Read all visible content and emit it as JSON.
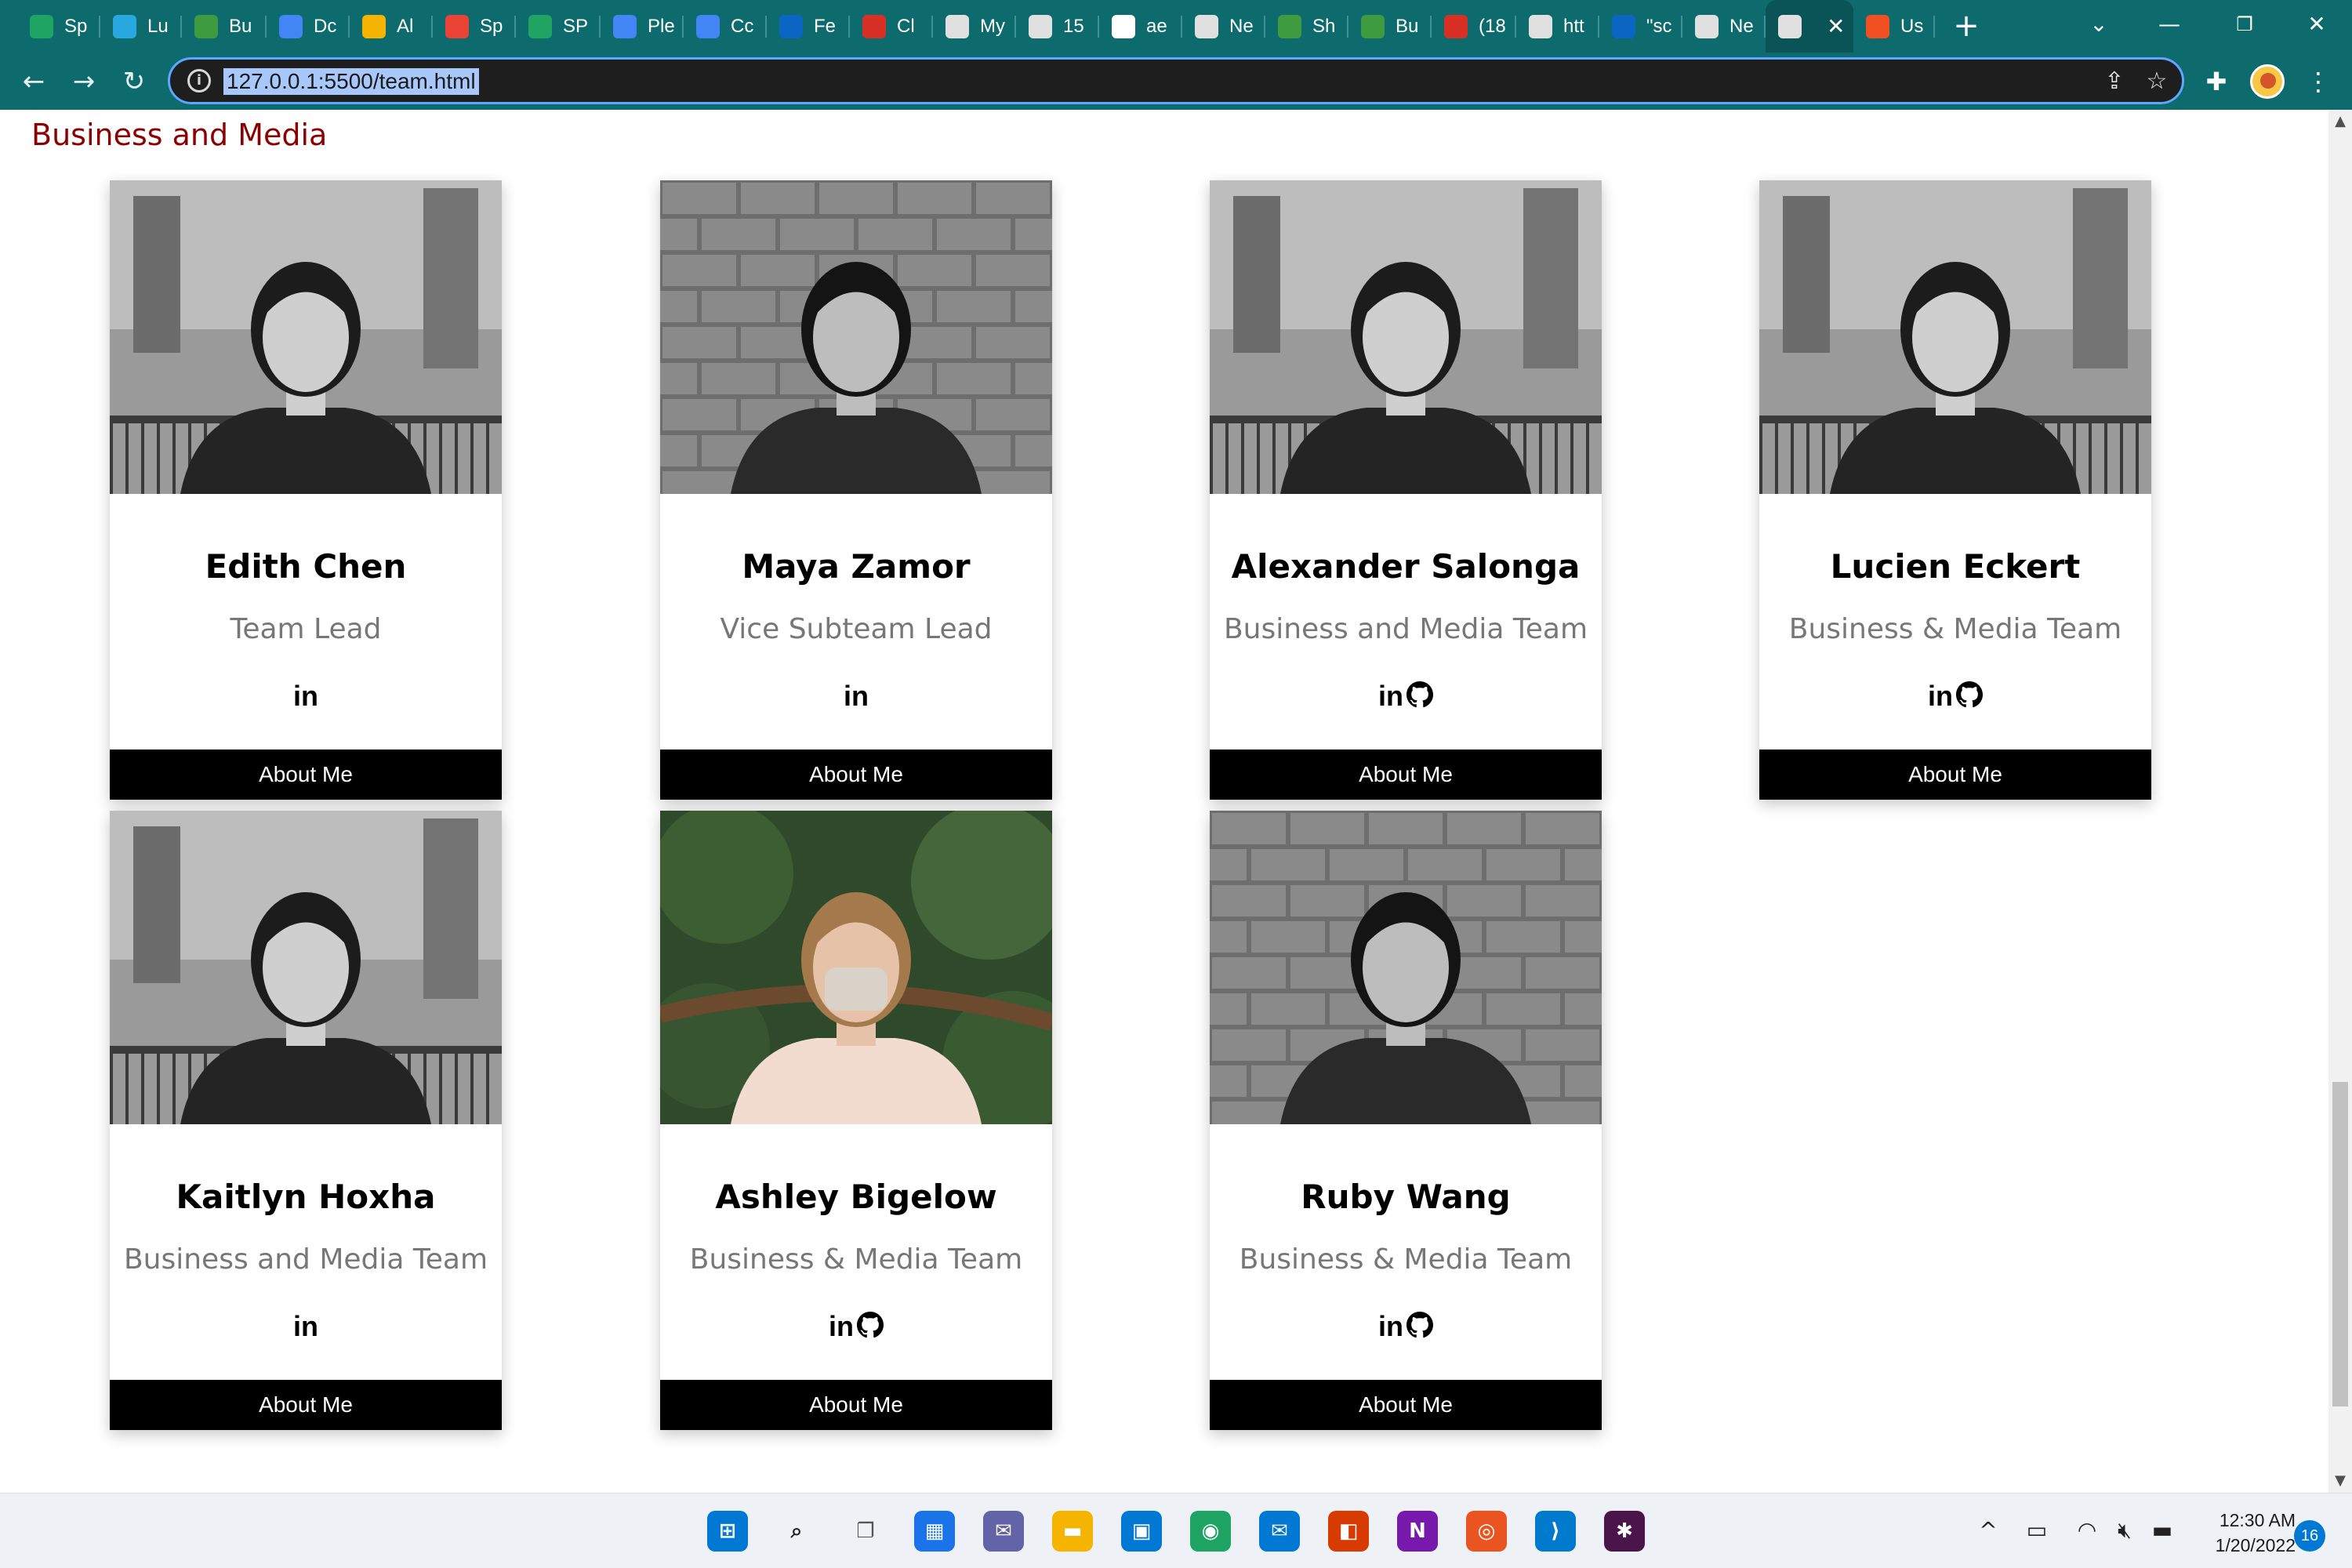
{
  "browser": {
    "tabs": [
      {
        "label": "Sp",
        "icon": "google-drive-icon",
        "color": "#1fa463"
      },
      {
        "label": "Lu",
        "icon": "lucid-icon",
        "color": "#29a8e0"
      },
      {
        "label": "Bu",
        "icon": "leaf-icon",
        "color": "#3f9b40"
      },
      {
        "label": "Dc",
        "icon": "google-docs-icon",
        "color": "#4285f4"
      },
      {
        "label": "Al",
        "icon": "google-slides-icon",
        "color": "#f4b400"
      },
      {
        "label": "Sp",
        "icon": "gmail-icon",
        "color": "#ea4335"
      },
      {
        "label": "SP",
        "icon": "google-drive-icon",
        "color": "#1fa463"
      },
      {
        "label": "Ple",
        "icon": "google-docs-icon",
        "color": "#4285f4"
      },
      {
        "label": "Cc",
        "icon": "google-calendar-icon",
        "color": "#4285f4"
      },
      {
        "label": "Fe",
        "icon": "linkedin-icon",
        "color": "#0a66c2"
      },
      {
        "label": "Cl",
        "icon": "shield-icon",
        "color": "#d93025"
      },
      {
        "label": "My",
        "icon": "globe-icon",
        "color": "#e0e0e0"
      },
      {
        "label": "15",
        "icon": "globe-icon",
        "color": "#e0e0e0"
      },
      {
        "label": "ae",
        "icon": "google-icon",
        "color": "#ffffff"
      },
      {
        "label": "Ne",
        "icon": "chrome-icon",
        "color": "#e0e0e0"
      },
      {
        "label": "Sh",
        "icon": "leaf-icon",
        "color": "#3f9b40"
      },
      {
        "label": "Bu",
        "icon": "leaf-icon",
        "color": "#3f9b40"
      },
      {
        "label": "(18",
        "icon": "handshake-icon",
        "color": "#d93025"
      },
      {
        "label": "htt",
        "icon": "globe-icon",
        "color": "#e0e0e0"
      },
      {
        "label": "\"sc",
        "icon": "linkedin-icon",
        "color": "#0a66c2"
      },
      {
        "label": "Ne",
        "icon": "chrome-icon",
        "color": "#e0e0e0"
      },
      {
        "label": "",
        "icon": "globe-icon",
        "color": "#e0e0e0",
        "active": true
      },
      {
        "label": "Us",
        "icon": "microsoft-icon",
        "color": "#f25022"
      }
    ],
    "url": "127.0.0.1:5500/team.html"
  },
  "page": {
    "section_title": "Business and Media",
    "button_label": "About Me",
    "members": [
      {
        "name": "Edith Chen",
        "role": "Team Lead",
        "github": false,
        "photo": "bw-outdoor"
      },
      {
        "name": "Maya Zamor",
        "role": "Vice Subteam Lead",
        "github": false,
        "photo": "bw-brick"
      },
      {
        "name": "Alexander Salonga",
        "role": "Business and Media Team",
        "github": true,
        "photo": "bw-outdoor"
      },
      {
        "name": "Lucien Eckert",
        "role": "Business & Media Team",
        "github": true,
        "photo": "bw-outdoor"
      },
      {
        "name": "Kaitlyn Hoxha",
        "role": "Business and Media Team",
        "github": false,
        "photo": "bw-outdoor"
      },
      {
        "name": "Ashley Bigelow",
        "role": "Business & Media Team",
        "github": true,
        "photo": "color-foliage"
      },
      {
        "name": "Ruby Wang",
        "role": "Business & Media Team",
        "github": true,
        "photo": "bw-brick"
      }
    ]
  },
  "taskbar": {
    "apps": [
      {
        "icon": "windows-start-icon",
        "color": "#0078d4"
      },
      {
        "icon": "search-icon",
        "color": "#222222"
      },
      {
        "icon": "task-view-icon",
        "color": "#555555"
      },
      {
        "icon": "widgets-icon",
        "color": "#1a73e8"
      },
      {
        "icon": "teams-chat-icon",
        "color": "#6264a7"
      },
      {
        "icon": "file-explorer-icon",
        "color": "#f4b400"
      },
      {
        "icon": "microsoft-store-icon",
        "color": "#0078d4"
      },
      {
        "icon": "chrome-icon",
        "color": "#1fa463"
      },
      {
        "icon": "mail-icon",
        "color": "#0078d4"
      },
      {
        "icon": "office-icon",
        "color": "#d83b01"
      },
      {
        "icon": "onenote-icon",
        "color": "#7719aa"
      },
      {
        "icon": "ubuntu-icon",
        "color": "#e95420"
      },
      {
        "icon": "vscode-icon",
        "color": "#007acc"
      },
      {
        "icon": "slack-icon",
        "color": "#4a154b"
      }
    ],
    "time": "12:30 AM",
    "date": "1/20/2022",
    "notification_count": "16"
  }
}
